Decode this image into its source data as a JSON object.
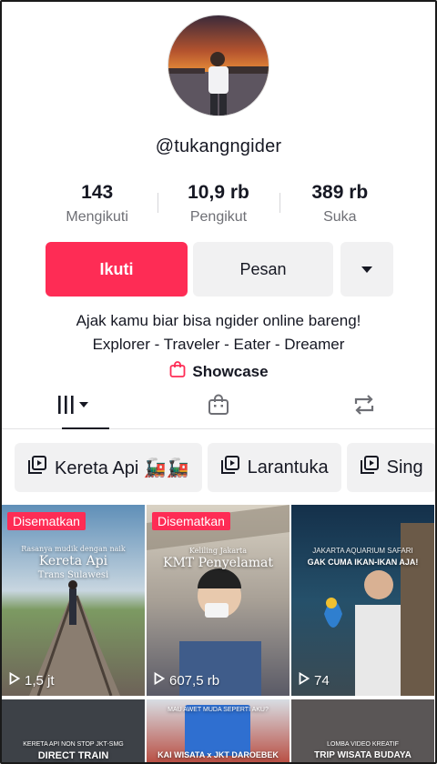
{
  "profile": {
    "username": "@tukangngider",
    "stats": [
      {
        "value": "143",
        "label": "Mengikuti"
      },
      {
        "value": "10,9 rb",
        "label": "Pengikut"
      },
      {
        "value": "389 rb",
        "label": "Suka"
      }
    ],
    "bio_line1": "Ajak kamu biar bisa ngider online bareng!",
    "bio_line2": "Explorer - Traveler - Eater - Dreamer"
  },
  "actions": {
    "follow_label": "Ikuti",
    "message_label": "Pesan",
    "more_icon": "chevron-down-icon"
  },
  "showcase": {
    "label": "Showcase",
    "icon": "shopping-bag-icon"
  },
  "tabs": [
    {
      "icon": "grid-icon",
      "active": true
    },
    {
      "icon": "shopping-bag-icon",
      "active": false
    },
    {
      "icon": "repost-icon",
      "active": false
    }
  ],
  "playlists": [
    {
      "label": "Kereta Api 🚂🚂"
    },
    {
      "label": "Larantuka"
    },
    {
      "label": "Sing"
    }
  ],
  "videos": [
    {
      "pinned_label": "Disematkan",
      "views": "1,5 jt",
      "title_small": "Rasanya mudik dengan naik",
      "title_big": "Kereta Api",
      "title_sub": "Trans Sulawesi"
    },
    {
      "pinned_label": "Disematkan",
      "views": "607,5 rb",
      "title_small": "Keliling Jakarta",
      "title_big": "KMT Penyelamat"
    },
    {
      "views": "74",
      "title_small": "JAKARTA AQUARIUM SAFARI",
      "title_big": "GAK CUMA IKAN-IKAN AJA!"
    },
    {
      "title_small": "KERETA API NON STOP JKT-SMG",
      "title_big": "DIRECT TRAIN"
    },
    {
      "title_small": "MAU AWET MUDA SEPERTI AKU?",
      "title_big": "KAI WISATA x JKT DAROEBEK"
    },
    {
      "title_small": "LOMBA VIDEO KREATIF",
      "title_big": "TRIP WISATA BUDAYA"
    }
  ],
  "colors": {
    "accent": "#fe2c55",
    "button_gray": "#f1f1f2",
    "text": "#161823",
    "muted": "#6e6f75"
  }
}
